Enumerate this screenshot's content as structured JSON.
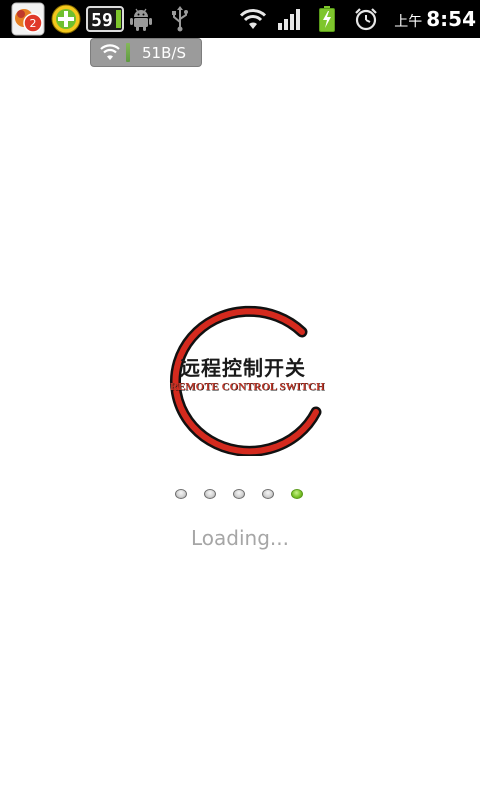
{
  "status_bar": {
    "notification_badge": "2",
    "app3_number": "59",
    "ampm": "上午",
    "time": "8:54",
    "icons": [
      "app-notification-icon",
      "plus-app-icon",
      "counter-app-icon",
      "android-debug-icon",
      "usb-icon",
      "wifi-icon",
      "signal-icon",
      "battery-charging-icon",
      "alarm-icon"
    ]
  },
  "net_speed": {
    "rate": "51B/S"
  },
  "logo": {
    "title_cn": "远程控制开关",
    "title_en": "REMOTE CONTROL SWITCH",
    "ring_color": "#d42a1e"
  },
  "loading": {
    "text": "Loading...",
    "dot_count": 5,
    "active_dot": 4,
    "active_color": "#7ec62c"
  }
}
